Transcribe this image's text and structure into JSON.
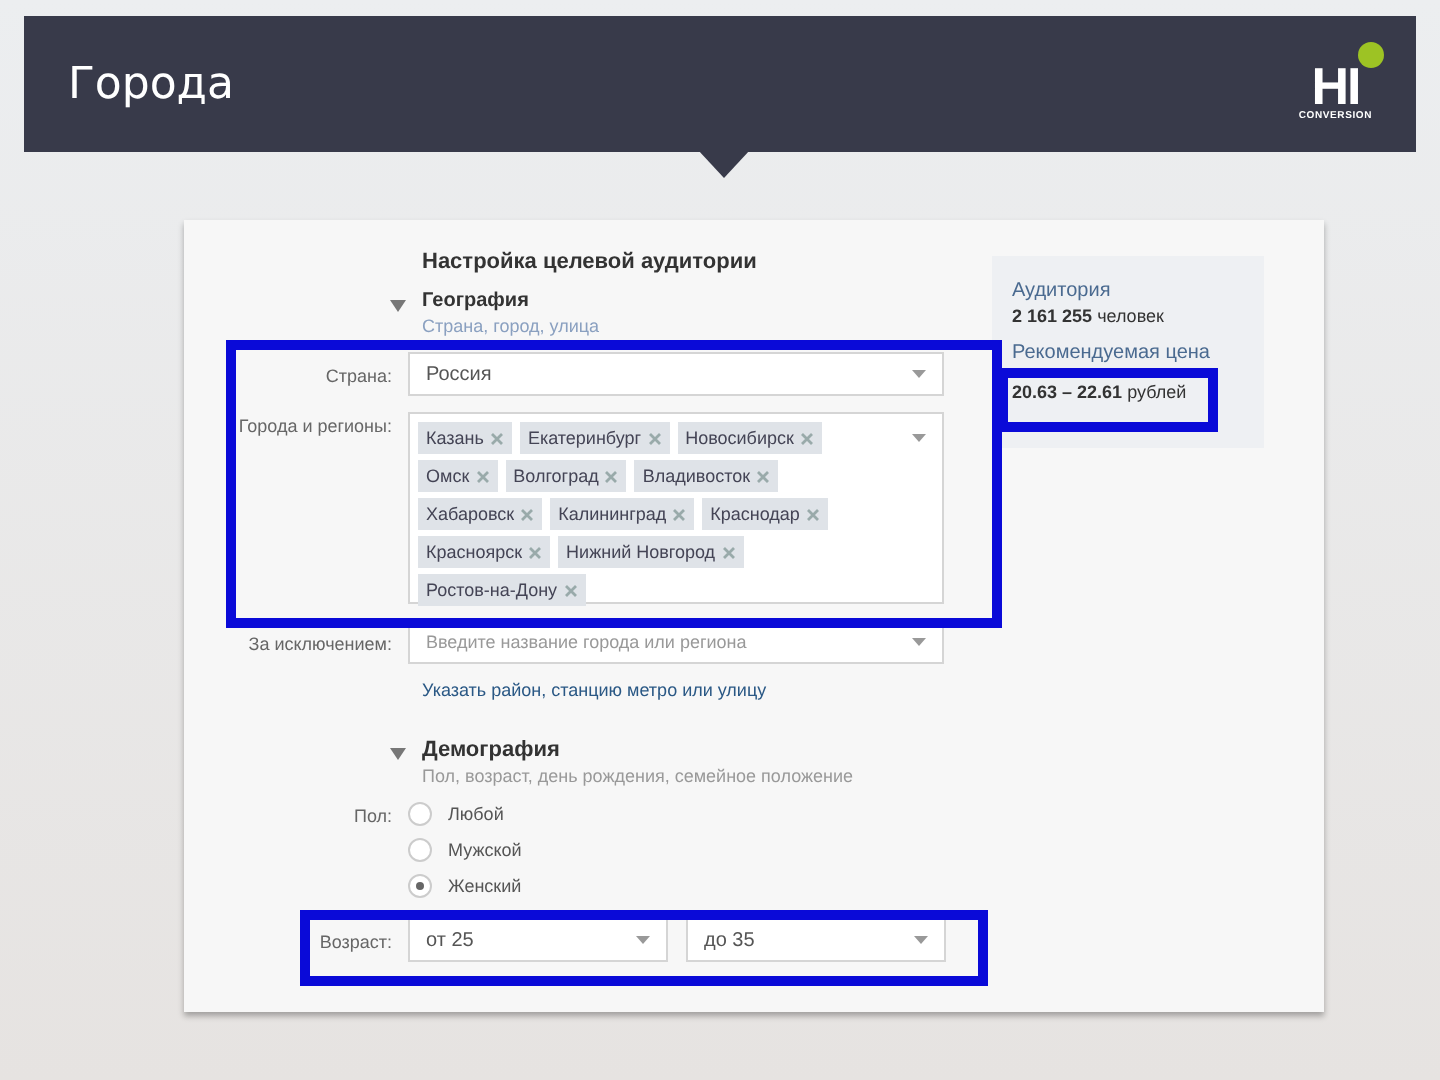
{
  "header": {
    "title": "Города",
    "logo": {
      "mark": "HI",
      "caption": "CONVERSION"
    }
  },
  "form": {
    "title": "Настройка целевой аудитории",
    "geography": {
      "title": "География",
      "subtitle": "Страна, город, улица",
      "expanded": true,
      "country": {
        "label": "Страна:",
        "value": "Россия"
      },
      "cities": {
        "label": "Города и регионы:",
        "tags": [
          "Казань",
          "Екатеринбург",
          "Новосибирск",
          "Омск",
          "Волгоград",
          "Владивосток",
          "Хабаровск",
          "Калининград",
          "Краснодар",
          "Красноярск",
          "Нижний Новгород",
          "Ростов-на-Дону"
        ]
      },
      "exclude": {
        "label": "За исключением:",
        "placeholder": "Введите название города или региона"
      },
      "link": "Указать район, станцию метро или улицу"
    },
    "demography": {
      "title": "Демография",
      "subtitle": "Пол, возраст, день рождения, семейное положение",
      "expanded": true,
      "gender": {
        "label": "Пол:",
        "options": [
          {
            "label": "Любой",
            "selected": false
          },
          {
            "label": "Мужской",
            "selected": false
          },
          {
            "label": "Женский",
            "selected": true
          }
        ]
      },
      "age": {
        "label": "Возраст:",
        "from": "от 25",
        "to": "до 35"
      }
    }
  },
  "summary": {
    "audience_title": "Аудитория",
    "audience_count": "2 161 255",
    "audience_unit": "человек",
    "price_title": "Рекомендуемая цена",
    "price": "20.63 – 22.61",
    "price_unit": "рублей"
  }
}
